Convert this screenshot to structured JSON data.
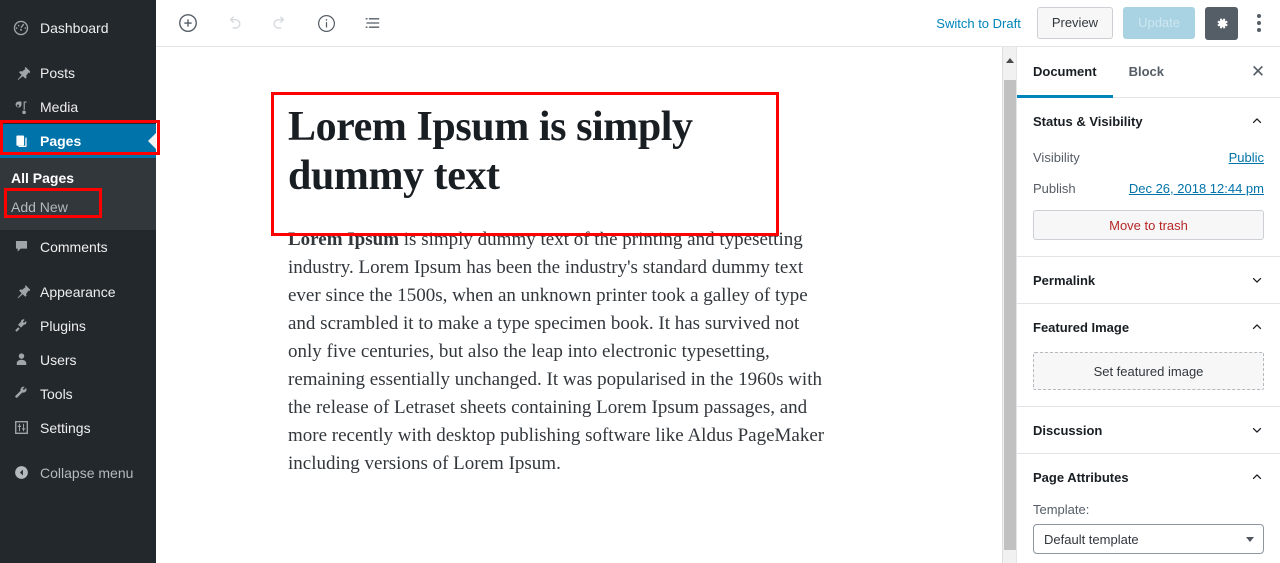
{
  "admin_menu": {
    "items": [
      {
        "label": "Dashboard",
        "icon": "dashboard-icon",
        "state": "normal"
      },
      {
        "label": "Posts",
        "icon": "pin-icon",
        "state": "normal"
      },
      {
        "label": "Media",
        "icon": "media-icon",
        "state": "normal"
      },
      {
        "label": "Pages",
        "icon": "pages-icon",
        "state": "current"
      },
      {
        "label": "Comments",
        "icon": "comments-icon",
        "state": "normal"
      },
      {
        "label": "Appearance",
        "icon": "appearance-icon",
        "state": "normal"
      },
      {
        "label": "Plugins",
        "icon": "plugins-icon",
        "state": "normal"
      },
      {
        "label": "Users",
        "icon": "users-icon",
        "state": "normal"
      },
      {
        "label": "Tools",
        "icon": "tools-icon",
        "state": "normal"
      },
      {
        "label": "Settings",
        "icon": "settings-icon",
        "state": "normal"
      },
      {
        "label": "Collapse menu",
        "icon": "collapse-icon",
        "state": "collapse"
      }
    ],
    "submenu": {
      "all_pages": "All Pages",
      "add_new": "Add New"
    },
    "colors": {
      "background": "#23282d",
      "submenu_background": "#32373c",
      "current_highlight": "#0073aa",
      "annotation": "#ff0000"
    }
  },
  "toolbar": {
    "add_block_title": "Add block",
    "undo_title": "Undo",
    "redo_title": "Redo",
    "info_title": "Content structure",
    "block_nav_title": "Block navigation",
    "switch_to_draft": "Switch to Draft",
    "preview": "Preview",
    "update": "Update",
    "settings_title": "Settings",
    "more_title": "More tools & options"
  },
  "editor": {
    "title": "Lorem Ipsum is simply dummy text",
    "paragraph_lead": "Lorem Ipsum",
    "paragraph_rest": " is simply dummy text of the printing and typesetting industry. Lorem Ipsum has been the industry's standard dummy text ever since the 1500s, when an unknown printer took a galley of type and scrambled it to make a type specimen book. It has survived not only five centuries, but also the leap into electronic typesetting, remaining essentially unchanged. It was popularised in the 1960s with the release of Letraset sheets containing Lorem Ipsum passages, and more recently with desktop publishing software like Aldus PageMaker including versions of Lorem Ipsum."
  },
  "settings_panel": {
    "tabs": [
      {
        "label": "Document",
        "active": true
      },
      {
        "label": "Block",
        "active": false
      }
    ],
    "close_label": "✕",
    "status_visibility": {
      "title": "Status & Visibility",
      "visibility_label": "Visibility",
      "visibility_value": "Public",
      "publish_label": "Publish",
      "publish_value": "Dec 26, 2018 12:44 pm",
      "move_to_trash": "Move to trash"
    },
    "permalink": {
      "title": "Permalink"
    },
    "featured_image": {
      "title": "Featured Image",
      "button": "Set featured image"
    },
    "discussion": {
      "title": "Discussion"
    },
    "page_attributes": {
      "title": "Page Attributes",
      "template_label": "Template:",
      "template_value": "Default template"
    },
    "colors": {
      "link": "#0073aa",
      "tab_active_underline": "#0085ba",
      "trash_text": "#b52727"
    }
  }
}
